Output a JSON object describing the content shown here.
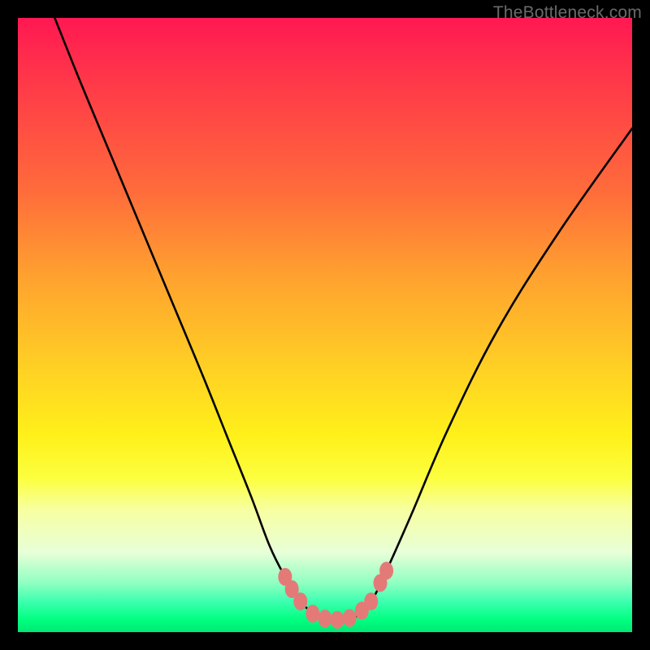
{
  "watermark": "TheBottleneck.com",
  "chart_data": {
    "type": "line",
    "title": "",
    "xlabel": "",
    "ylabel": "",
    "xlim": [
      0,
      100
    ],
    "ylim": [
      0,
      100
    ],
    "series": [
      {
        "name": "bottleneck-curve",
        "x": [
          6,
          10,
          15,
          20,
          25,
          30,
          34,
          38,
          41,
          43.5,
          46,
          49,
          52,
          55,
          57.5,
          60,
          64,
          70,
          78,
          88,
          100
        ],
        "y": [
          100,
          90,
          78,
          66,
          54,
          42,
          32,
          22,
          14,
          9,
          5,
          2.5,
          2,
          2.5,
          5,
          10,
          19,
          33,
          49,
          65,
          82
        ]
      }
    ],
    "markers": {
      "name": "highlight-dots",
      "color": "#e47a78",
      "points": [
        {
          "x": 43.5,
          "y": 9
        },
        {
          "x": 44.6,
          "y": 7
        },
        {
          "x": 46.0,
          "y": 5
        },
        {
          "x": 48.0,
          "y": 3
        },
        {
          "x": 50.0,
          "y": 2.2
        },
        {
          "x": 52.0,
          "y": 2
        },
        {
          "x": 54.0,
          "y": 2.3
        },
        {
          "x": 56.0,
          "y": 3.5
        },
        {
          "x": 57.5,
          "y": 5
        },
        {
          "x": 59.0,
          "y": 8
        },
        {
          "x": 60.0,
          "y": 10
        }
      ]
    }
  }
}
